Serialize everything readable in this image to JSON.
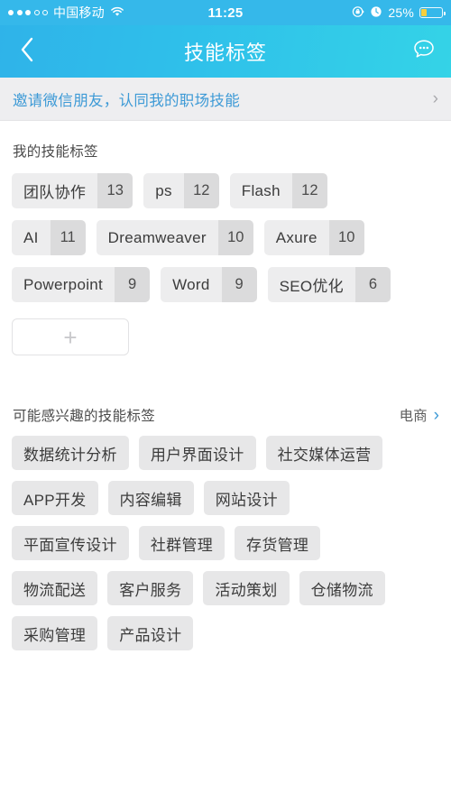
{
  "status_bar": {
    "signal_dots_filled": 3,
    "signal_dots_total": 5,
    "carrier": "中国移动",
    "wifi_icon": "wifi-icon",
    "time": "11:25",
    "rotation_lock_icon": "rotation-lock-icon",
    "alarm_icon": "alarm-clock-icon",
    "battery_percent": "25%",
    "battery_fill_ratio": 0.25,
    "battery_color": "#f7cf3d"
  },
  "navbar": {
    "back_icon": "chevron-left-icon",
    "title": "技能标签",
    "action_icon": "chat-bubble-icon",
    "gradient_start": "#2fb3e9",
    "gradient_end": "#34d3e7"
  },
  "invite_banner": {
    "text": "邀请微信朋友，认同我的职场技能",
    "chevron_icon": "chevron-right-icon",
    "text_color": "#3d9ad6",
    "background": "#eeeef0"
  },
  "my_tags_section": {
    "title": "我的技能标签",
    "rows": [
      [
        {
          "label": "团队协作",
          "count": "13"
        },
        {
          "label": "ps",
          "count": "12"
        },
        {
          "label": "Flash",
          "count": "12"
        }
      ],
      [
        {
          "label": "AI",
          "count": "11"
        },
        {
          "label": "Dreamweaver",
          "count": "10"
        },
        {
          "label": "Axure",
          "count": "10"
        }
      ],
      [
        {
          "label": "Powerpoint",
          "count": "9"
        },
        {
          "label": "Word",
          "count": "9"
        },
        {
          "label": "SEO优化",
          "count": "6"
        }
      ]
    ],
    "add_button": {
      "icon": "plus-icon",
      "glyph": "+"
    },
    "tag_label_bg": "#ededee",
    "tag_count_bg": "#dbdbdc"
  },
  "suggested_section": {
    "title": "可能感兴趣的技能标签",
    "category": "电商",
    "chevron_icon": "chevron-right-icon",
    "rows": [
      [
        "数据统计分析",
        "用户界面设计",
        "社交媒体运营"
      ],
      [
        "APP开发",
        "内容编辑",
        "网站设计"
      ],
      [
        "平面宣传设计",
        "社群管理",
        "存货管理"
      ],
      [
        "物流配送",
        "客户服务",
        "活动策划",
        "仓储物流"
      ],
      [
        "采购管理",
        "产品设计"
      ]
    ],
    "tag_bg": "#e7e7e8"
  }
}
